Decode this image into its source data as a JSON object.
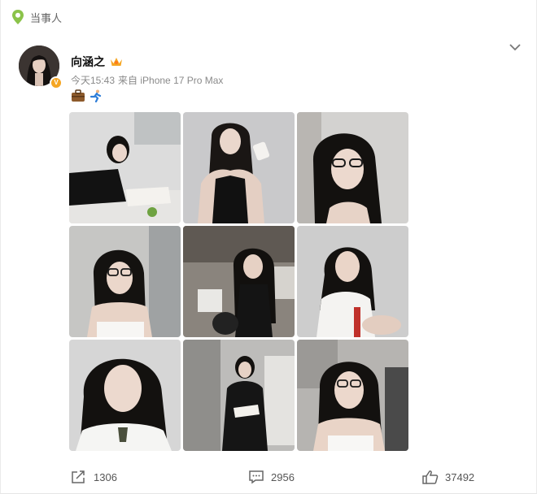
{
  "topbar": {
    "label": "当事人"
  },
  "post": {
    "author": "向涵之",
    "time": "今天15:43",
    "source": "来自 iPhone 17 Pro Max",
    "emojis": [
      "briefcase-emoji",
      "runner-emoji"
    ],
    "photos": [
      {
        "name": "photo-woman-lying-reading"
      },
      {
        "name": "photo-woman-black-halter-cup"
      },
      {
        "name": "photo-woman-glasses-closeup"
      },
      {
        "name": "photo-woman-glasses-white-top"
      },
      {
        "name": "photo-woman-sitting-black-dress"
      },
      {
        "name": "photo-woman-white-shirt-sitting"
      },
      {
        "name": "photo-woman-white-shirt-tie"
      },
      {
        "name": "photo-woman-black-suit-reading"
      },
      {
        "name": "photo-woman-glasses-hand-shoulder"
      }
    ]
  },
  "actions": {
    "share_count": "1306",
    "comment_count": "2956",
    "like_count": "37492"
  },
  "colors": {
    "badge": "#f5a623",
    "pin": "#8bc34a"
  }
}
